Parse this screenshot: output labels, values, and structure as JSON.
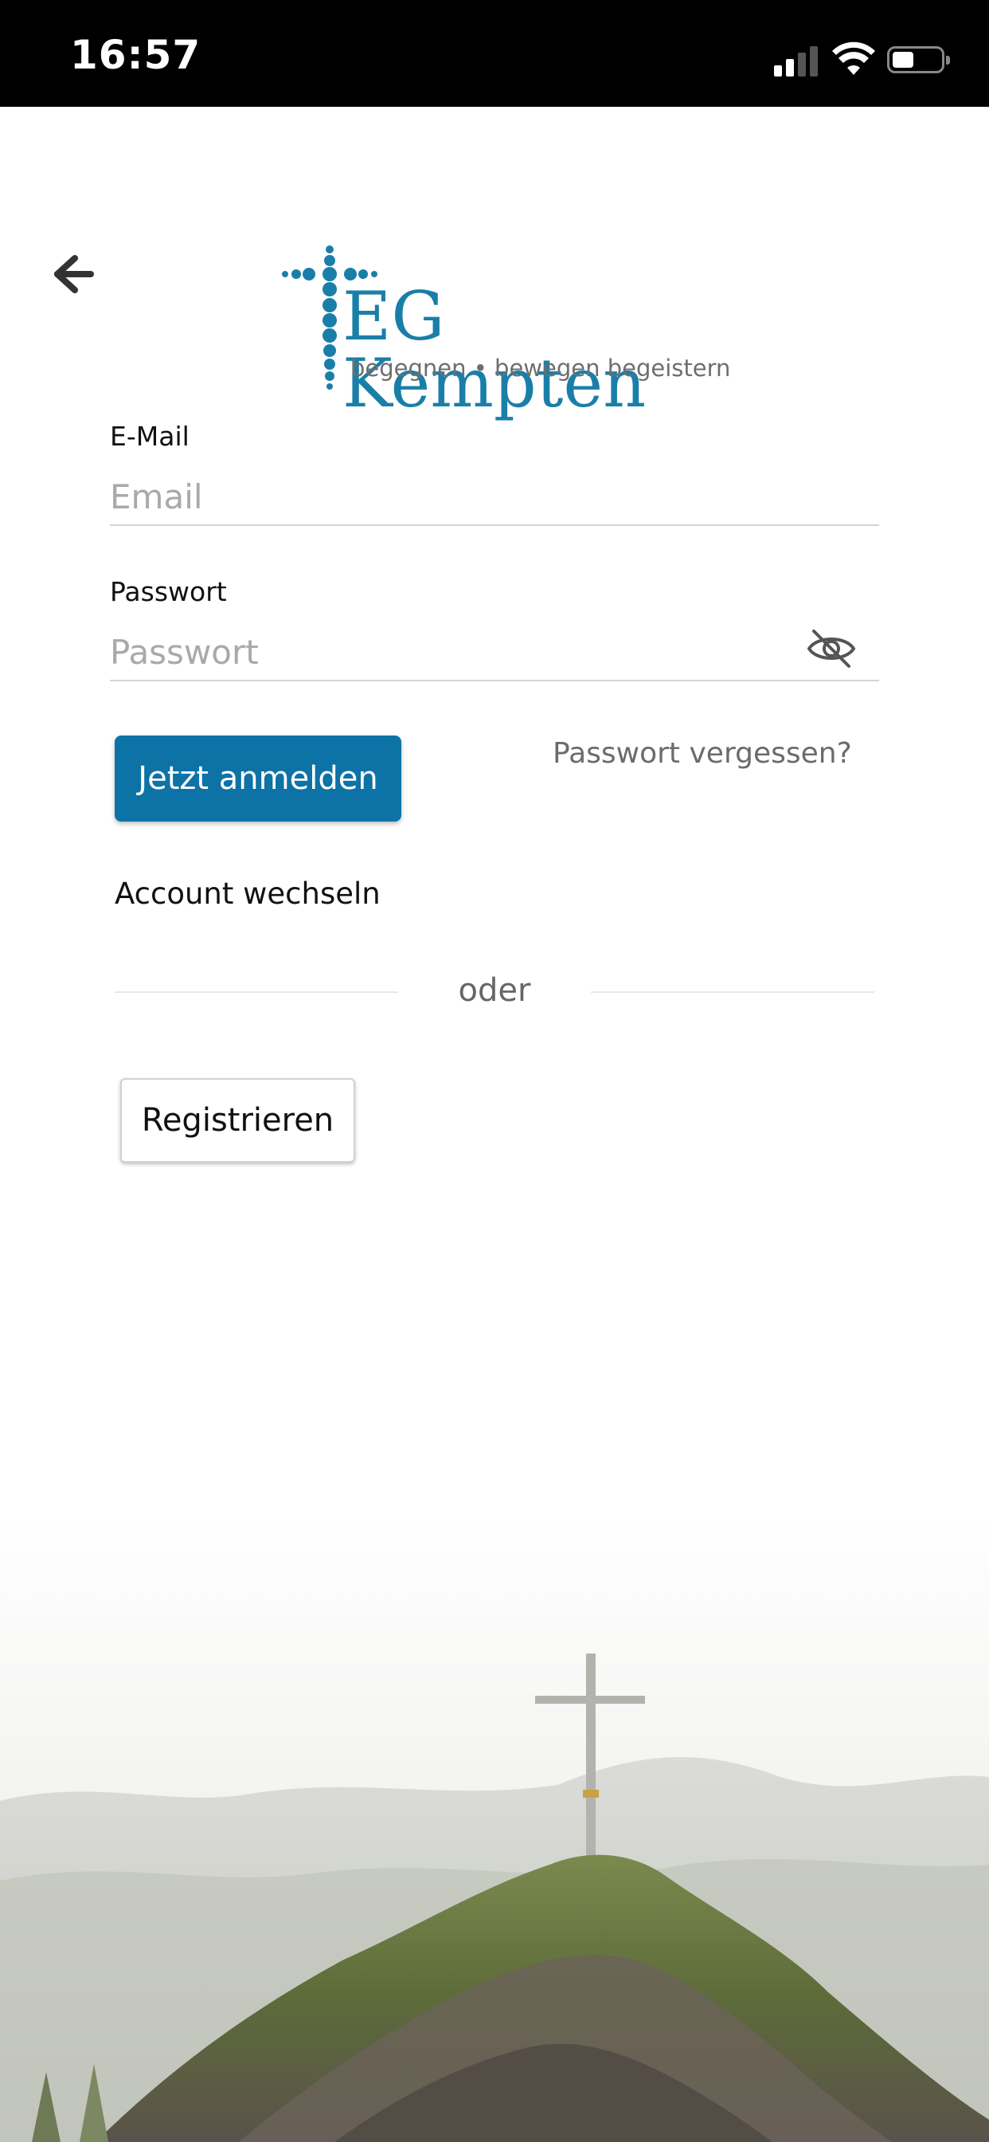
{
  "status_bar": {
    "time": "16:57",
    "icons": [
      "cellular-signal-icon",
      "wifi-icon",
      "battery-icon"
    ]
  },
  "header": {
    "back_icon": "arrow-left-icon",
    "logo": {
      "title": "EG Kempten",
      "tagline": "begegnen • bewegen  begeistern"
    }
  },
  "form": {
    "email_label": "E-Mail",
    "email_placeholder": "Email",
    "email_value": "",
    "password_label": "Passwort",
    "password_placeholder": "Passwort",
    "password_value": "",
    "visibility_icon": "eye-slash-icon"
  },
  "actions": {
    "login_label": "Jetzt anmelden",
    "forgot_password": "Passwort vergessen?",
    "switch_account": "Account wechseln",
    "divider": "oder",
    "register_label": "Registrieren"
  },
  "colors": {
    "brand": "#0d72a6",
    "logo_blue": "#1a7fa8",
    "status_bar": "#000000"
  }
}
